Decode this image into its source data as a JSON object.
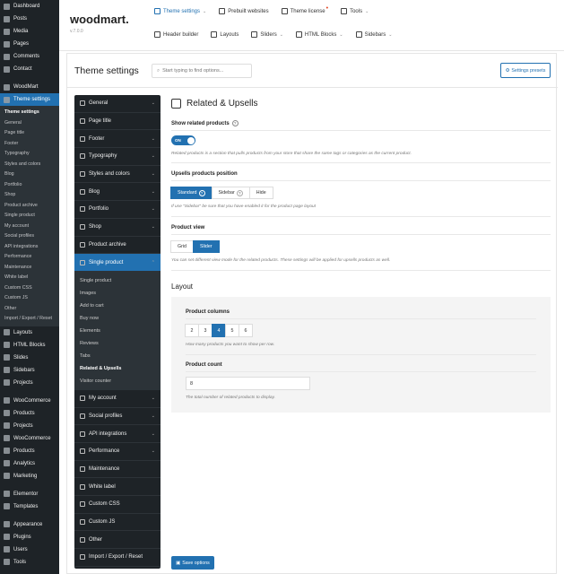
{
  "wp_sidebar": {
    "top_items": [
      {
        "label": "Dashboard",
        "icon": "dashboard-icon"
      },
      {
        "label": "Posts",
        "icon": "pin-icon"
      },
      {
        "label": "Media",
        "icon": "media-icon"
      },
      {
        "label": "Pages",
        "icon": "page-icon"
      },
      {
        "label": "Comments",
        "icon": "comment-icon"
      },
      {
        "label": "Contact",
        "icon": "mail-icon"
      },
      {
        "label": "WoodMart",
        "icon": "woodmart-icon"
      },
      {
        "label": "Theme settings",
        "icon": "sliders-icon"
      }
    ],
    "submenu": [
      "Theme settings",
      "General",
      "Page title",
      "Footer",
      "Typography",
      "Styles and colors",
      "Blog",
      "Portfolio",
      "Shop",
      "Product archive",
      "Single product",
      "My account",
      "Social profiles",
      "API integrations",
      "Performance",
      "Maintenance",
      "White label",
      "Custom CSS",
      "Custom JS",
      "Other",
      "Import / Export / Reset"
    ],
    "bottom_items": [
      {
        "label": "Layouts",
        "icon": "layout-icon"
      },
      {
        "label": "HTML Blocks",
        "icon": "html-icon"
      },
      {
        "label": "Slides",
        "icon": "slides-icon"
      },
      {
        "label": "Sidebars",
        "icon": "sidebar-icon"
      },
      {
        "label": "Projects",
        "icon": "project-icon"
      },
      {
        "label": "WooCommerce",
        "icon": "woocommerce-icon"
      },
      {
        "label": "Products",
        "icon": "product-icon"
      },
      {
        "label": "Projects",
        "icon": "project-icon"
      },
      {
        "label": "WooCommerce",
        "icon": "woocommerce-icon"
      },
      {
        "label": "Products",
        "icon": "product-icon"
      },
      {
        "label": "Analytics",
        "icon": "analytics-icon"
      },
      {
        "label": "Marketing",
        "icon": "marketing-icon"
      },
      {
        "label": "Elementor",
        "icon": "elementor-icon"
      },
      {
        "label": "Templates",
        "icon": "templates-icon"
      },
      {
        "label": "Appearance",
        "icon": "brush-icon"
      },
      {
        "label": "Plugins",
        "icon": "plugin-icon"
      },
      {
        "label": "Users",
        "icon": "users-icon"
      },
      {
        "label": "Tools",
        "icon": "wrench-icon"
      }
    ]
  },
  "header": {
    "logo": "woodmart.",
    "version": "v.7.0.0",
    "nav_row1": [
      {
        "label": "Theme settings",
        "icon": "sliders-icon",
        "chevron": true
      },
      {
        "label": "Prebuilt websites",
        "icon": "download-icon",
        "chevron": false
      },
      {
        "label": "Theme license",
        "icon": "key-icon",
        "chevron": false
      },
      {
        "label": "Tools",
        "icon": "wrench-icon",
        "chevron": true
      }
    ],
    "nav_row2": [
      {
        "label": "Header builder",
        "icon": "header-icon",
        "chevron": false
      },
      {
        "label": "Layouts",
        "icon": "layout-icon",
        "chevron": false
      },
      {
        "label": "Sliders",
        "icon": "slides-icon",
        "chevron": true
      },
      {
        "label": "HTML Blocks",
        "icon": "html-icon",
        "chevron": true
      },
      {
        "label": "Sidebars",
        "icon": "sidebar-icon",
        "chevron": true
      }
    ]
  },
  "settings": {
    "title": "Theme settings",
    "search_placeholder": "Start typing to find options...",
    "presets_label": "Settings presets",
    "save_label": "Save options"
  },
  "settings_nav": {
    "items_top": [
      "General",
      "Page title",
      "Footer",
      "Typography",
      "Styles and colors",
      "Blog",
      "Portfolio",
      "Shop",
      "Product archive"
    ],
    "active": "Single product",
    "sub": [
      "Single product",
      "Images",
      "Add to cart",
      "Buy now",
      "Elements",
      "Reviews",
      "Tabs",
      "Related & Upsells",
      "Visitor counter"
    ],
    "active_sub": "Related & Upsells",
    "items_bottom": [
      "My account",
      "Social profiles",
      "API integrations",
      "Performance",
      "Maintenance",
      "White label",
      "Custom CSS",
      "Custom JS",
      "Other",
      "Import / Export / Reset"
    ]
  },
  "section": {
    "title": "Related & Upsells",
    "show_related": {
      "label": "Show related products",
      "toggle": "ON",
      "desc": "Related products is a section that pulls products from your store that share the same tags or categories as the current product."
    },
    "upsells_position": {
      "label": "Upsells products position",
      "options": [
        "Standard",
        "Sidebar",
        "Hide"
      ],
      "selected": "Standard",
      "desc": "If use \"Sidebar\" be sure that you have enabled it for the product page layout"
    },
    "product_view": {
      "label": "Product view",
      "options": [
        "Grid",
        "Slider"
      ],
      "selected": "Slider",
      "desc": "You can set different view mode for the related products. These settings will be applied for upsells products as well."
    },
    "layout": {
      "title": "Layout",
      "columns": {
        "label": "Product columns",
        "options": [
          "2",
          "3",
          "4",
          "5",
          "6"
        ],
        "selected": "4",
        "desc": "How many products you want to show per row."
      },
      "count": {
        "label": "Product count",
        "value": "8",
        "desc": "The total number of related products to display."
      }
    }
  },
  "colors": {
    "accent": "#2271b1",
    "sidebar_bg": "#1e2327"
  }
}
